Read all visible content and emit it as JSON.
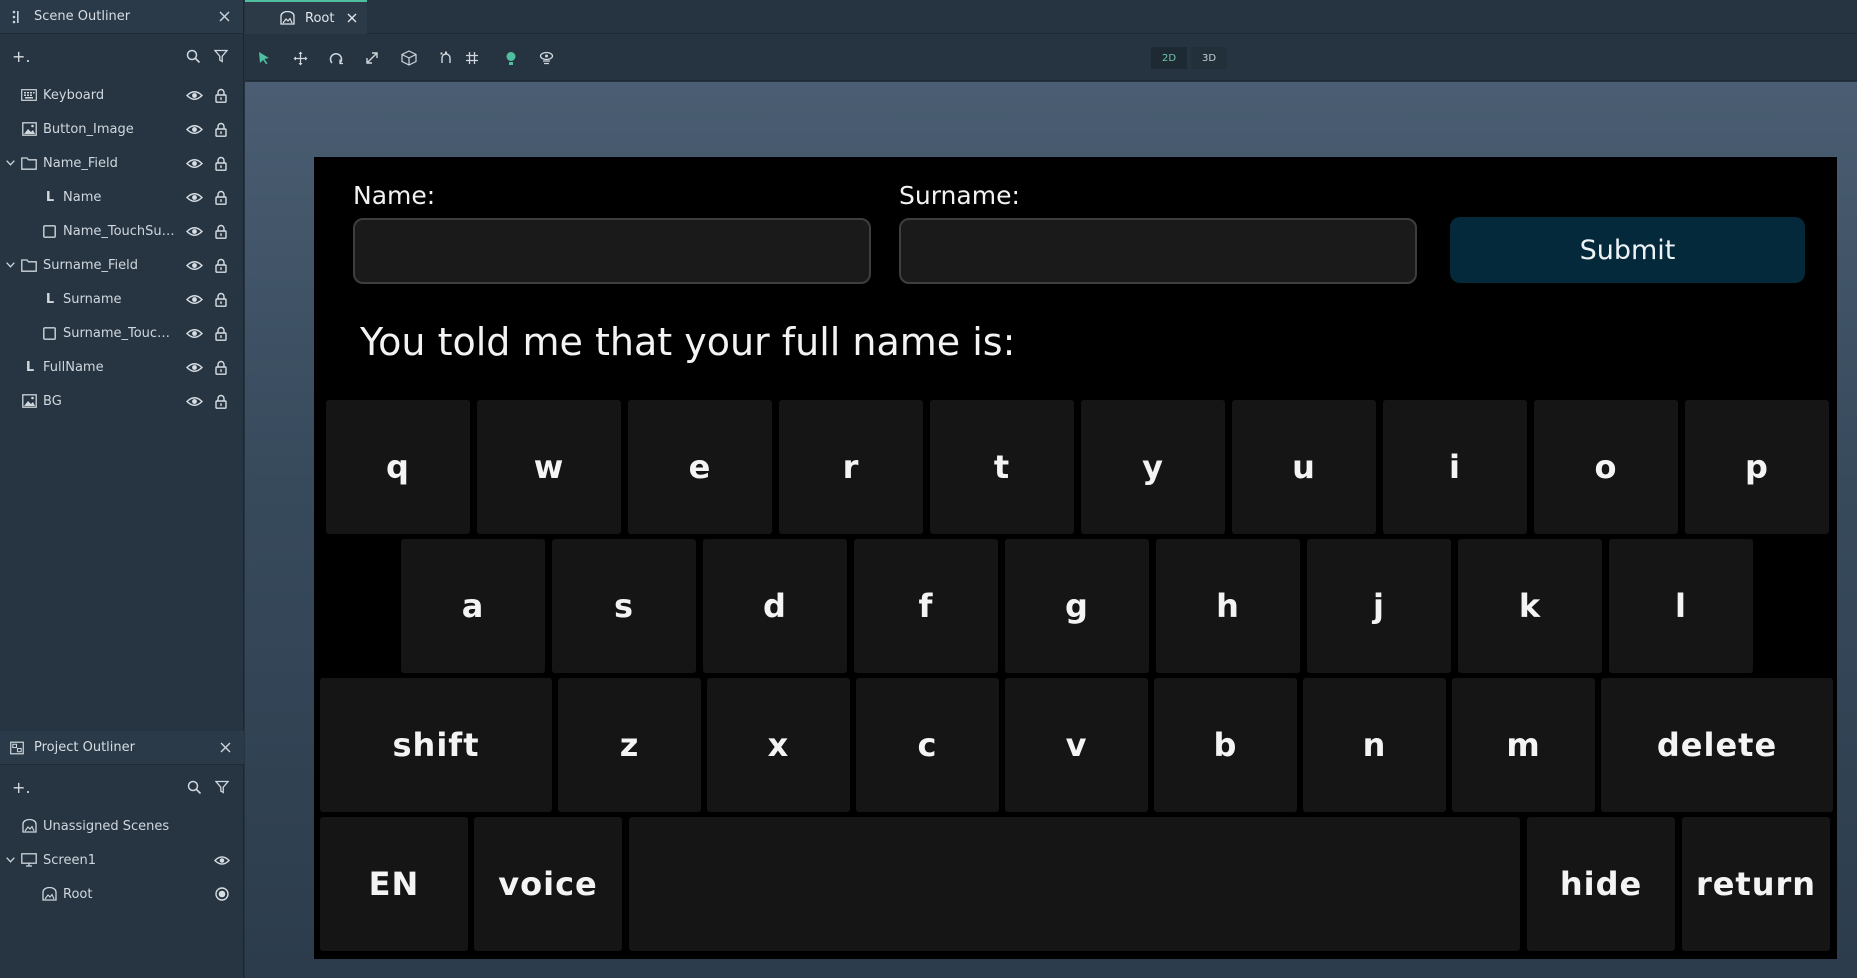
{
  "scene_outliner": {
    "title": "Scene Outliner",
    "add_label": "+.",
    "items": [
      {
        "label": "Keyboard",
        "icon": "keyboard-icon"
      },
      {
        "label": "Button_Image",
        "icon": "image-icon"
      },
      {
        "label": "Name_Field",
        "icon": "folder-icon",
        "expanded": true
      },
      {
        "label": "Name",
        "icon": "text-icon"
      },
      {
        "label": "Name_TouchSurfa...",
        "icon": "square-icon"
      },
      {
        "label": "Surname_Field",
        "icon": "folder-icon",
        "expanded": true
      },
      {
        "label": "Surname",
        "icon": "text-icon"
      },
      {
        "label": "Surname_TouchS...",
        "icon": "square-icon"
      },
      {
        "label": "FullName",
        "icon": "text-icon"
      },
      {
        "label": "BG",
        "icon": "image-icon"
      }
    ],
    "text_glyph": "L"
  },
  "project_outliner": {
    "title": "Project Outliner",
    "add_label": "+.",
    "items": [
      {
        "label": "Unassigned Scenes",
        "icon": "scene-icon"
      },
      {
        "label": "Screen1",
        "icon": "monitor-icon",
        "expanded": true
      },
      {
        "label": "Root",
        "icon": "scene-icon"
      }
    ]
  },
  "tabs": [
    {
      "label": "Root",
      "icon": "scene-icon"
    }
  ],
  "toolbar": {
    "tools": [
      "select-tool-icon",
      "move-tool-icon",
      "rotate-tool-icon",
      "scale-tool-icon",
      "box-tool-icon",
      "snap-icon",
      "grid-icon",
      "light-icon",
      "camera-icon"
    ],
    "mode_2d": "2D",
    "mode_3d": "3D",
    "active_mode": "2D"
  },
  "canvas": {
    "name_label": "Name:",
    "surname_label": "Surname:",
    "name_value": "",
    "surname_value": "",
    "submit_label": "Submit",
    "fullname_text": "You told me that your full name is:",
    "keyboard": {
      "row1": [
        "q",
        "w",
        "e",
        "r",
        "t",
        "y",
        "u",
        "i",
        "o",
        "p"
      ],
      "row2": [
        "a",
        "s",
        "d",
        "f",
        "g",
        "h",
        "j",
        "k",
        "l"
      ],
      "row3": [
        "shift",
        "z",
        "x",
        "c",
        "v",
        "b",
        "n",
        "m",
        "delete"
      ],
      "row4": [
        "EN",
        "voice",
        "",
        "hide",
        "return"
      ]
    }
  },
  "colors": {
    "accent": "#4fbf9f",
    "submit_bg": "#03293a",
    "key_bg": "#151515",
    "canvas_bg": "#000000"
  }
}
